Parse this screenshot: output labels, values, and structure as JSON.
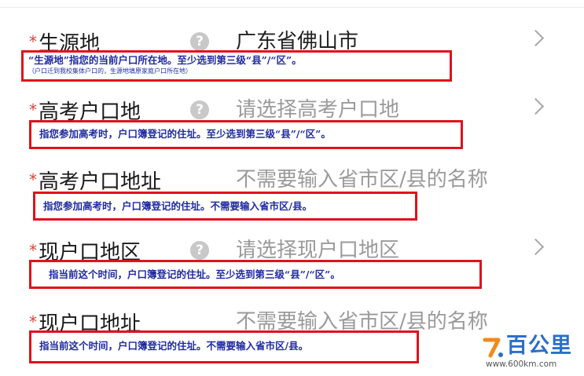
{
  "form": {
    "rows": [
      {
        "label": "生源地",
        "value": "广东省佛山市",
        "note": "“生源地”指您的当前户口所在地。至少选到第三级“县”/“区”。",
        "subnote": "（户口迁到我校集体户口的，生源地填原家庭户口所在地）"
      },
      {
        "label": "高考户口地",
        "value": "请选择高考户口地",
        "note": "指您参加高考时，户口簿登记的住址。至少选到第三级“县”/“区”。"
      },
      {
        "label": "高考户口地址",
        "value": "不需要输入省市区/县的名称",
        "note": "指您参加高考时，户口簿登记的住址。不需要输入省市区/县。"
      },
      {
        "label": "现户口地区",
        "value": "请选择现户口地区",
        "note": "指当前这个时间，户口簿登记的住址。至少选到第三级“县”/“区”。"
      },
      {
        "label": "现户口地址",
        "value": "不需要输入省市区/县的名称",
        "note": "指当前这个时间，户口簿登记的住址。不需要输入省市区/县。"
      }
    ],
    "required_mark": "*",
    "help_glyph": "?"
  },
  "watermark": {
    "brand": "百公里",
    "url": "www.600km.com"
  },
  "colors": {
    "annotation_border": "#e0111b",
    "annotation_text": "#1f2aa0",
    "required_star": "#d9413a",
    "placeholder": "#9a9a9a"
  },
  "icons": {
    "help": "help-circle-icon",
    "chevron": "chevron-right-icon",
    "logo": "brand-logo-icon"
  }
}
